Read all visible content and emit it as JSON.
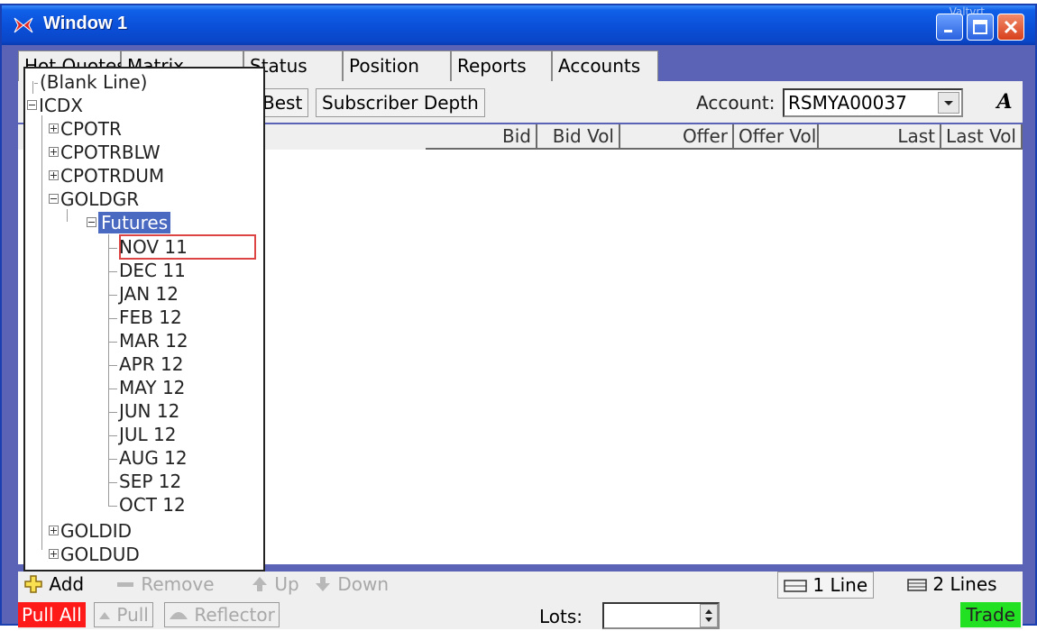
{
  "window": {
    "title": "Window 1",
    "faint_label": "Valtvrt"
  },
  "tabs": [
    "Hot Quotes",
    "Matrix",
    "Status",
    "Position",
    "Reports",
    "Accounts"
  ],
  "toolbar": {
    "best_label": "Best",
    "subscriber_depth_label": "Subscriber Depth",
    "account_label": "Account:",
    "account_value": "RSMYA00037",
    "font_button": "A"
  },
  "columns": [
    "Bid",
    "Bid Vol",
    "Offer",
    "Offer Vol",
    "Last",
    "Last Vol"
  ],
  "tree": {
    "blank_line": "(Blank Line)",
    "root": "ICDX",
    "groups": [
      "CPOTR",
      "CPOTRBLW",
      "CPOTRDUM",
      "GOLDGR"
    ],
    "futures": "Futures",
    "contracts": [
      "NOV 11",
      "DEC 11",
      "JAN 12",
      "FEB 12",
      "MAR 12",
      "APR 12",
      "MAY 12",
      "JUN 12",
      "JUL 12",
      "AUG 12",
      "SEP 12",
      "OCT 12"
    ],
    "after_groups": [
      "GOLDID",
      "GOLDUD"
    ]
  },
  "actions": {
    "add": "Add",
    "remove": "Remove",
    "up": "Up",
    "down": "Down",
    "one_line": "1 Line",
    "two_lines": "2 Lines"
  },
  "bottom": {
    "pull_all": "Pull All",
    "pull": "Pull",
    "reflector": "Reflector",
    "lots_label": "Lots:",
    "trade": "Trade"
  },
  "colors": {
    "titlebar": "#0a4fd8",
    "frame": "#5a63b5",
    "selected": "#4a6ac2",
    "pull_all": "#ff1a1a",
    "trade": "#22e022",
    "highlight_box": "#d44444"
  }
}
